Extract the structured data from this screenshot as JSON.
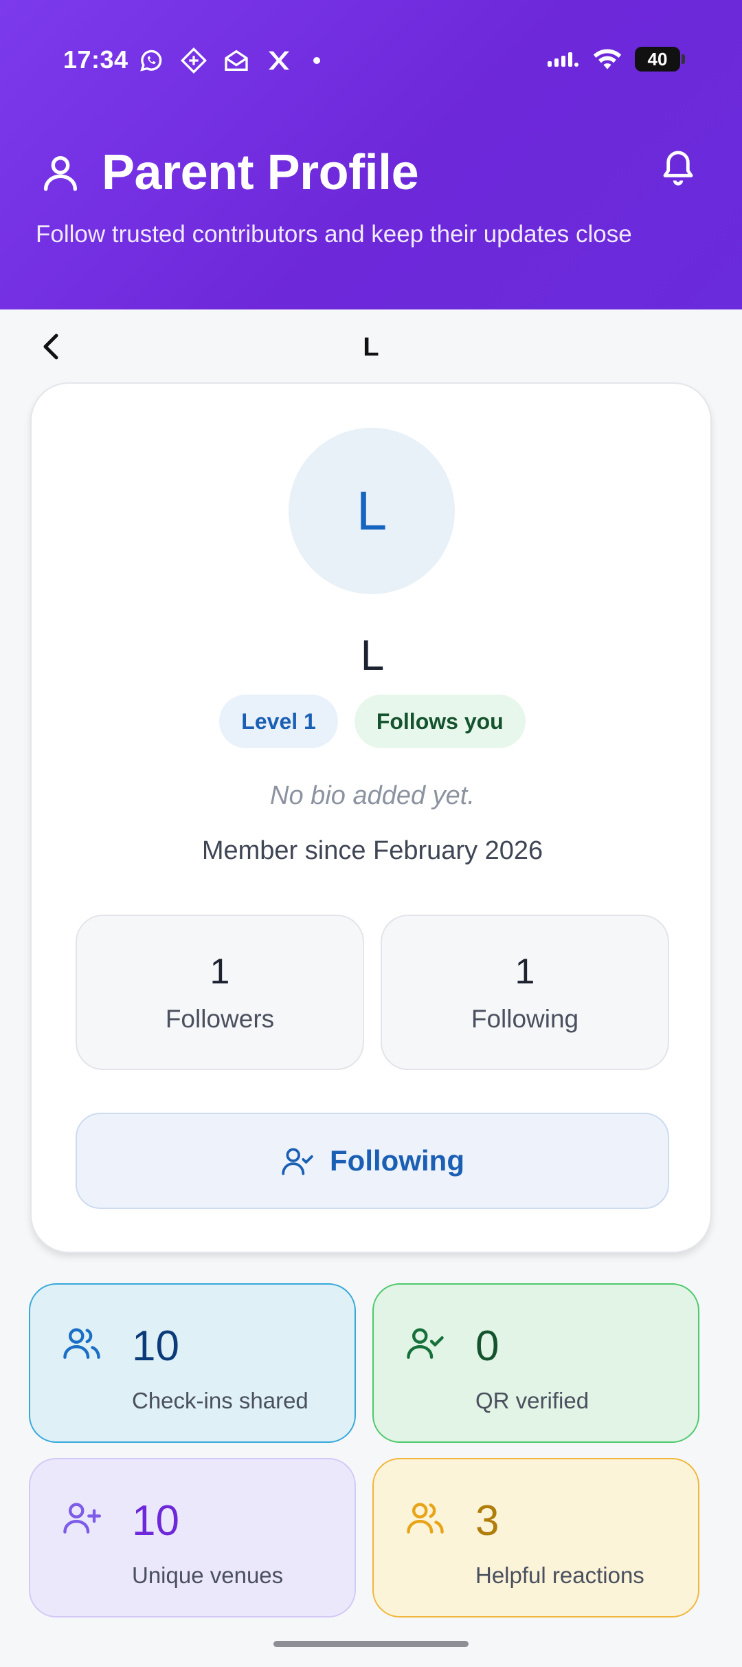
{
  "status_bar": {
    "time": "17:34",
    "battery": "40",
    "notification_icons": [
      "whatsapp-icon",
      "diamond-app-icon",
      "mail-open-icon",
      "x-app-icon"
    ]
  },
  "header": {
    "title": "Parent Profile",
    "subtitle": "Follow trusted contributors and keep their updates close",
    "gradient_colors": [
      "#7c3aed",
      "#6a2bdc"
    ]
  },
  "topbar": {
    "title": "L"
  },
  "profile": {
    "avatar_initial": "L",
    "name": "L",
    "badges": {
      "level": "Level 1",
      "follows_you": "Follows you"
    },
    "bio": "No bio added yet.",
    "member_since": "Member since February 2026",
    "stats": {
      "followers": {
        "value": "1",
        "label": "Followers"
      },
      "following": {
        "value": "1",
        "label": "Following"
      }
    },
    "follow_button_label": "Following",
    "accent_color": "#1a5fb4"
  },
  "metrics": [
    {
      "icon": "users-icon",
      "value": "10",
      "label": "Check-ins shared",
      "color": "#35a8d9"
    },
    {
      "icon": "user-check-icon",
      "value": "0",
      "label": "QR verified",
      "color": "#4cc96a"
    },
    {
      "icon": "user-plus-icon",
      "value": "10",
      "label": "Unique venues",
      "color": "#7c5ce8"
    },
    {
      "icon": "users-icon",
      "value": "3",
      "label": "Helpful reactions",
      "color": "#f2b73a"
    }
  ]
}
